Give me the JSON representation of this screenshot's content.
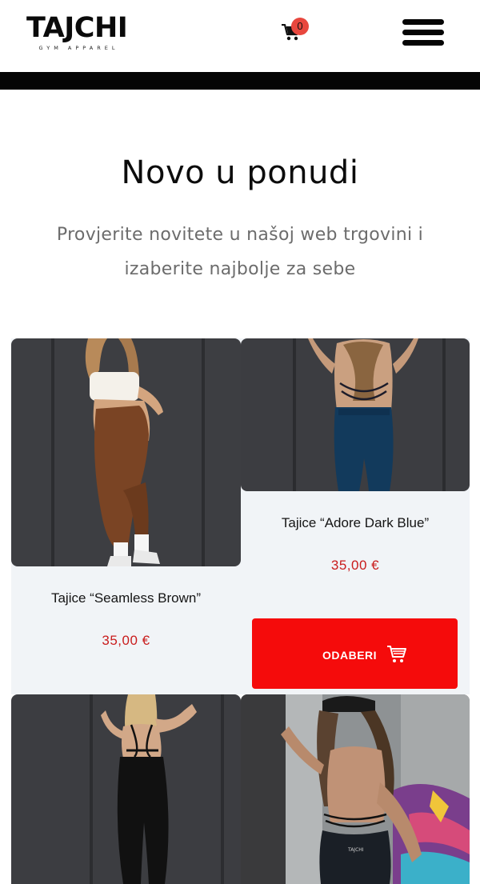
{
  "header": {
    "logo_text": "TAJCHI",
    "logo_tagline": "GYM APPAREL",
    "cart_count": "0",
    "icons": {
      "cart": "cart-icon",
      "menu": "hamburger-menu-icon"
    }
  },
  "intro": {
    "title": "Novo u ponudi",
    "subtitle": "Provjerite novitete u našoj web trgovini i izaberite najbolje za sebe"
  },
  "products": [
    {
      "name": "Tajice “Seamless Brown”",
      "price": "35,00 €",
      "legging_color": "#7a4424"
    },
    {
      "name": "Tajice “Adore Dark Blue”",
      "price": "35,00 €",
      "legging_color": "#123a5c",
      "button_label": "ODABERI"
    },
    {
      "legging_color": "#111111"
    },
    {
      "legging_color": "#1a1f26"
    }
  ],
  "colors": {
    "accent_red": "#f50b0b",
    "price_red": "#c91c1c",
    "badge_red": "#e8473e",
    "card_bg": "#f1f4f7"
  }
}
